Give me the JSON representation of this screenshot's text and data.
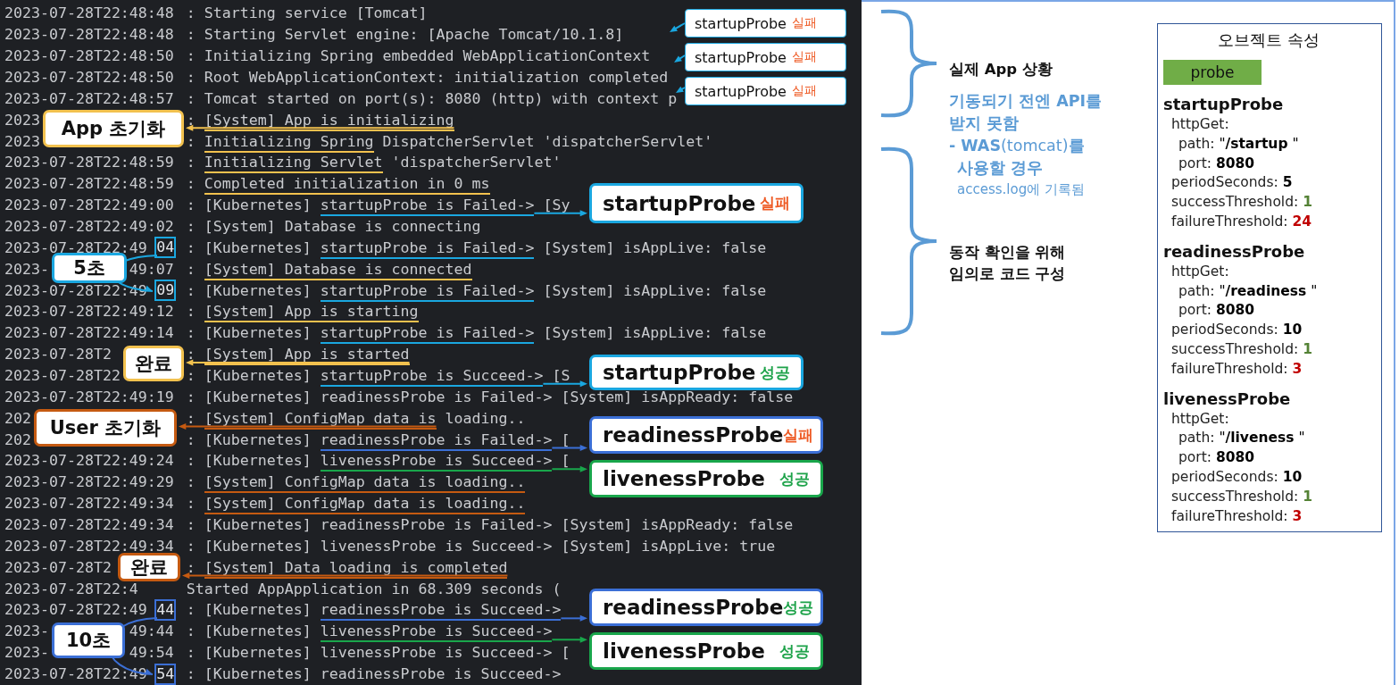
{
  "log": {
    "lines": [
      {
        "stamp": "2023-07-28T22:48:48",
        "lead": ": Starting service [Tomcat]"
      },
      {
        "stamp": "2023-07-28T22:48:48",
        "lead": ": Starting Servlet engine: [Apache Tomcat/10.1.8]"
      },
      {
        "stamp": "2023-07-28T22:48:50",
        "lead": ": Initializing Spring embedded WebApplicationContext"
      },
      {
        "stamp": "2023-07-28T22:48:50",
        "lead": ": Root WebApplicationContext: initialization completed"
      },
      {
        "stamp": "2023-07-28T22:48:57",
        "lead": ": Tomcat started on port(s): 8080 (http) with context p"
      },
      {
        "stamp": "2023",
        "lead": ": ",
        "marked": "[System] App is initializing",
        "color": "#f2c14e"
      },
      {
        "stamp": "2023",
        "lead": ": ",
        "marked": "Initializing Spring",
        "rest": " DispatcherServlet 'dispatcherServlet'",
        "color": "#f2c14e"
      },
      {
        "stamp": "2023-07-28T22:48:59",
        "lead": ": ",
        "marked": "Initializing Servlet",
        "rest": " 'dispatcherServlet'",
        "color": "#f2c14e"
      },
      {
        "stamp": "2023-07-28T22:48:59",
        "lead": ": ",
        "marked": "Completed initialization in 0 ms",
        "color": "#f2c14e"
      },
      {
        "stamp": "2023-07-28T22:49:00",
        "lead": ": [Kubernetes] ",
        "marked": "startupProbe is Failed->",
        "rest": " [Sy",
        "color": "#1aa7e0"
      },
      {
        "stamp": "2023-07-28T22:49:02",
        "lead": ": [System] Database is connecting"
      },
      {
        "stamp": "2023-07-28T22:49",
        "box": {
          "text": "04",
          "color": "#1aa7e0"
        },
        "lead": ": [Kubernetes] ",
        "marked": "startupProbe is Failed->",
        "rest": " [System] isAppLive: false",
        "color": "#1aa7e0"
      },
      {
        "stamp": "2023-",
        "tail": "49:07",
        "lead": ": ",
        "marked": "[System] Database is connected",
        "color": "#f2c14e"
      },
      {
        "stamp": "2023-07-28T22:49",
        "box": {
          "text": "09",
          "color": "#1aa7e0"
        },
        "lead": ": [Kubernetes] ",
        "marked": "startupProbe is Failed->",
        "rest": " [System] isAppLive: false",
        "color": "#1aa7e0"
      },
      {
        "stamp": "2023-07-28T22:49:12",
        "lead": ": ",
        "marked": "[System] App is starting",
        "color": "#f2c14e"
      },
      {
        "stamp": "2023-07-28T22:49:14",
        "lead": ": [Kubernetes] ",
        "marked": "startupProbe is Failed->",
        "rest": " [System] isAppLive: false",
        "color": "#1aa7e0"
      },
      {
        "stamp": "2023-07-28T2",
        "lead": ": ",
        "marked": "[System] App is started",
        "color": "#f2c14e"
      },
      {
        "stamp": "2023-07-28T22",
        "lead": ": [Kubernetes] ",
        "marked": "startupProbe is Succeed->",
        "rest": " [S",
        "color": "#1aa7e0"
      },
      {
        "stamp": "2023-07-28T22:49:19",
        "lead": ": [Kubernetes] readinessProbe is Failed-> [System] isAppReady: false"
      },
      {
        "stamp": "202",
        "lead": ": ",
        "marked": "[System] ConfigMap data is",
        "rest": " loading..",
        "color": "#c55a11"
      },
      {
        "stamp": "202",
        "lead": ": [Kubernetes] ",
        "marked": "readinessProbe is Failed->",
        "rest": " [",
        "color": "#3b6fd6"
      },
      {
        "stamp": "2023-07-28T22:49:24",
        "lead": ": [Kubernetes] ",
        "marked": "livenessProbe is Succeed->",
        "rest": " [",
        "color": "#19a64b"
      },
      {
        "stamp": "2023-07-28T22:49:29",
        "lead": ": ",
        "marked": "[System] ConfigMap data is loading..",
        "color": "#c55a11"
      },
      {
        "stamp": "2023-07-28T22:49:34",
        "lead": ": ",
        "marked": "[System] ConfigMap data is loading..",
        "color": "#c55a11"
      },
      {
        "stamp": "2023-07-28T22:49:34",
        "lead": ": [Kubernetes] readinessProbe is Failed-> [System] isAppReady: false"
      },
      {
        "stamp": "2023-07-28T22:49:34",
        "lead": ": [Kubernetes] livenessProbe is Succeed-> [System] isAppLive: true"
      },
      {
        "stamp": "2023-07-28T2",
        "lead": ": ",
        "marked": "[System] Data loading is completed",
        "color": "#c55a11"
      },
      {
        "stamp": "2023-07-28T22:4",
        "lead": "Started AppApplication in 68.309 seconds ("
      },
      {
        "stamp": "2023-07-28T22:49",
        "box": {
          "text": "44",
          "color": "#3b6fd6"
        },
        "lead": ": [Kubernetes] ",
        "marked": "readinessProbe is Succeed->",
        "color": "#3b6fd6"
      },
      {
        "stamp": "2023-",
        "tail": "49:44",
        "lead": ": [Kubernetes] ",
        "marked": "livenessProbe is Succeed->",
        "color": "#19a64b"
      },
      {
        "stamp": "2023-",
        "tail": "49:54",
        "lead": ": [Kubernetes] livenessProbe is Succeed-> ["
      },
      {
        "stamp": "2023-07-28T22:49",
        "box": {
          "text": "54",
          "color": "#3b6fd6"
        },
        "lead": ": [Kubernetes] readinessProbe is Succeed->"
      }
    ]
  },
  "callouts": [
    {
      "kind": "tag",
      "label": "startupProbe",
      "status": "실패",
      "failed": true,
      "color": "#1aa7e0"
    },
    {
      "kind": "tag",
      "label": "startupProbe",
      "status": "실패",
      "failed": true,
      "color": "#1aa7e0"
    },
    {
      "kind": "tag",
      "label": "startupProbe",
      "status": "실패",
      "failed": true,
      "color": "#1aa7e0"
    },
    {
      "kind": "note",
      "label": "App 초기화",
      "color": "#f2c14e"
    },
    {
      "kind": "probe",
      "label": "startupProbe",
      "status": "실패",
      "failed": true,
      "color": "#1aa7e0"
    },
    {
      "kind": "note",
      "label": "5초",
      "color": "#1aa7e0"
    },
    {
      "kind": "note",
      "label": "완료",
      "color": "#f2c14e"
    },
    {
      "kind": "probe",
      "label": "startupProbe",
      "status": "성공",
      "failed": false,
      "color": "#1aa7e0"
    },
    {
      "kind": "note",
      "label": "User 초기화",
      "color": "#c55a11"
    },
    {
      "kind": "probe",
      "label": "readinessProbe",
      "status": "실패",
      "failed": true,
      "color": "#3b6fd6"
    },
    {
      "kind": "probe",
      "label": "livenessProbe",
      "status": "성공",
      "failed": false,
      "color": "#19a64b"
    },
    {
      "kind": "note",
      "label": "완료",
      "color": "#c55a11"
    },
    {
      "kind": "probe",
      "label": "readinessProbe",
      "status": "성공",
      "failed": false,
      "color": "#3b6fd6"
    },
    {
      "kind": "note",
      "label": "10초",
      "color": "#3b6fd6"
    },
    {
      "kind": "probe",
      "label": "livenessProbe",
      "status": "성공",
      "failed": false,
      "color": "#19a64b"
    }
  ],
  "notes": {
    "heading": "실제 App 상황",
    "lines": [
      {
        "text": "기동되기 전엔 API를",
        "kind": "strong"
      },
      {
        "text": "받지 못함",
        "kind": "strong"
      },
      {
        "text": "**- WAS**(tomcat)**를**",
        "kind": "mixed"
      },
      {
        "text": "사용할 경우",
        "kind": "strong_sub"
      },
      {
        "text": "access.log에 기록됨",
        "kind": "sub"
      }
    ]
  },
  "code_note": {
    "lines": [
      "동작 확인을 위해",
      "임의로 코드 구성"
    ]
  },
  "properties": {
    "title": "오브젝트 속성",
    "chip": "probe",
    "sections": [
      {
        "name": "startupProbe",
        "fields": [
          {
            "key": "httpGet:",
            "children": [
              {
                "key": "path:",
                "value": "\"**/startup** \"",
                "kind": "plain"
              },
              {
                "key": "port:",
                "value": "8080",
                "kind": "strong"
              }
            ]
          },
          {
            "key": "periodSeconds:",
            "value": "5",
            "kind": "strong"
          },
          {
            "key": "successThreshold:",
            "value": "1",
            "kind": "good"
          },
          {
            "key": "failureThreshold:",
            "value": "24",
            "kind": "bad"
          }
        ]
      },
      {
        "name": "readinessProbe",
        "fields": [
          {
            "key": "httpGet:",
            "children": [
              {
                "key": "path:",
                "value": "\"**/readiness** \"",
                "kind": "plain"
              },
              {
                "key": "port:",
                "value": "8080",
                "kind": "strong"
              }
            ]
          },
          {
            "key": "periodSeconds:",
            "value": "10",
            "kind": "strong"
          },
          {
            "key": "successThreshold:",
            "value": "1",
            "kind": "good"
          },
          {
            "key": "failureThreshold:",
            "value": "3",
            "kind": "bad"
          }
        ]
      },
      {
        "name": "livenessProbe",
        "fields": [
          {
            "key": "httpGet:",
            "children": [
              {
                "key": "path:",
                "value": "\"**/liveness** \"",
                "kind": "plain"
              },
              {
                "key": "port:",
                "value": "8080",
                "kind": "strong"
              }
            ]
          },
          {
            "key": "periodSeconds:",
            "value": "10",
            "kind": "strong"
          },
          {
            "key": "successThreshold:",
            "value": "1",
            "kind": "good"
          },
          {
            "key": "failureThreshold:",
            "value": "3",
            "kind": "bad"
          }
        ]
      }
    ]
  }
}
